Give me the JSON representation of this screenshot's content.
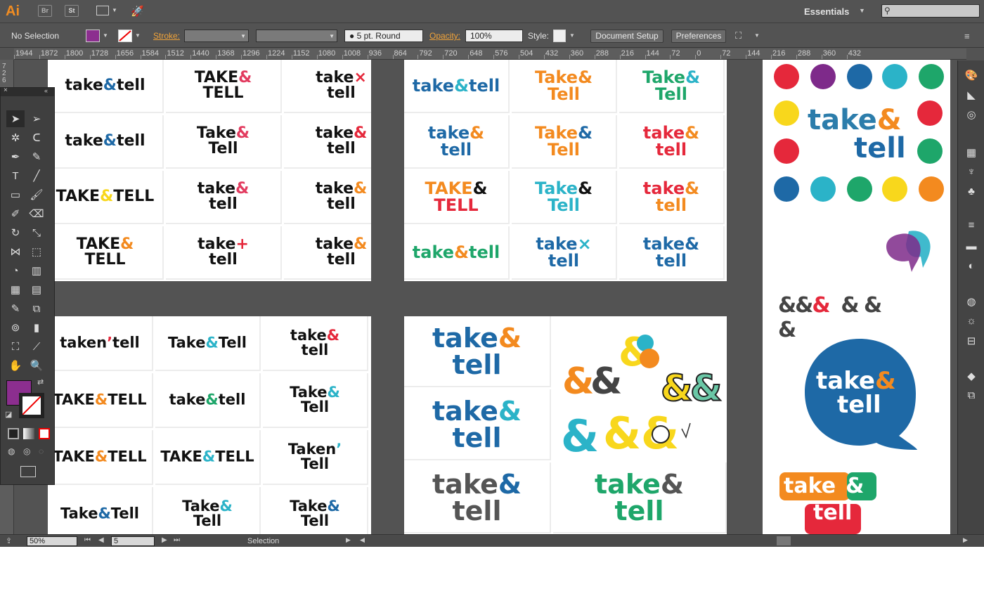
{
  "app": {
    "logo": "Ai",
    "bridge": "Br",
    "stock": "St",
    "workspace": "Essentials"
  },
  "control_bar": {
    "selection": "No Selection",
    "stroke_label": "Stroke:",
    "brush": "5 pt. Round",
    "opacity_label": "Opacity:",
    "opacity": "100%",
    "style_label": "Style:",
    "doc_setup": "Document Setup",
    "preferences": "Preferences"
  },
  "ruler_labels": [
    "1944",
    "1872",
    "1800",
    "1728",
    "1656",
    "1584",
    "1512",
    "1440",
    "1368",
    "1296",
    "1224",
    "1152",
    "1080",
    "1008",
    "936",
    "864",
    "792",
    "720",
    "648",
    "576",
    "504",
    "432",
    "360",
    "288",
    "216",
    "144",
    "72",
    "0",
    "72",
    "144",
    "216",
    "288",
    "360",
    "432"
  ],
  "vruler_labels": [
    "7",
    "2",
    "6"
  ],
  "status": {
    "zoom": "50%",
    "artboard": "5",
    "tool": "Selection"
  },
  "colors": {
    "blue": "#1e69a6",
    "orange": "#f38a1f",
    "red": "#e5283b",
    "green": "#1ea66a",
    "teal": "#2bb3c8",
    "purple": "#7e2a8a",
    "yellow": "#f8d71c",
    "pink": "#e23b5f",
    "black": "#111111",
    "gray": "#555555",
    "fill_swatch": "#8c2e8f"
  },
  "dots": [
    "red",
    "purple",
    "blue",
    "teal",
    "green",
    "yellow",
    "red",
    "red",
    "green",
    "blue",
    "teal",
    "green",
    "yellow",
    "orange"
  ],
  "logos": {
    "tl": [
      [
        "take",
        "&",
        "tell",
        "",
        "black",
        "blue",
        "black"
      ],
      [
        "TAKE",
        "&",
        "TELL",
        "",
        "black",
        "pink",
        "black"
      ],
      [
        "take",
        "×",
        "tell",
        "",
        "black",
        "red",
        "black"
      ],
      [
        "take",
        "&",
        "tell",
        "",
        "black",
        "blue",
        "black"
      ],
      [
        "Take",
        "&",
        "Tell",
        "",
        "black",
        "pink",
        "black"
      ],
      [
        "take",
        "&",
        "tell",
        "",
        "black",
        "red",
        "black"
      ],
      [
        "TAKE",
        "&",
        "TELL",
        "",
        "black",
        "yellow",
        "black"
      ],
      [
        "take",
        "&",
        "tell",
        "",
        "black",
        "pink",
        "black"
      ],
      [
        "take",
        "&",
        "tell",
        "",
        "black",
        "orange",
        "black"
      ],
      [
        "TAKE",
        "&",
        "TELL",
        "",
        "black",
        "orange",
        "black"
      ],
      [
        "take",
        "+",
        "tell",
        "",
        "black",
        "red",
        "black"
      ],
      [
        "take",
        "&",
        "tell",
        "",
        "black",
        "orange",
        "black"
      ]
    ],
    "tm": [
      [
        "take",
        "&",
        "tell",
        "",
        "blue",
        "teal",
        "blue"
      ],
      [
        "Take",
        "&",
        "Tell",
        "",
        "orange",
        "orange",
        "orange"
      ],
      [
        "Take",
        "&",
        "Tell",
        "",
        "green",
        "teal",
        "green"
      ],
      [
        "take",
        "&",
        "tell",
        "",
        "blue",
        "orange",
        "blue"
      ],
      [
        "Take",
        "&",
        "Tell",
        "",
        "orange",
        "blue",
        "orange"
      ],
      [
        "take",
        "&",
        "tell",
        "",
        "red",
        "orange",
        "red"
      ],
      [
        "TAKE",
        "&",
        "TELL",
        "",
        "orange",
        "black",
        "red"
      ],
      [
        "Take",
        "&",
        "Tell",
        "",
        "teal",
        "black",
        "teal"
      ],
      [
        "take",
        "&",
        "tell",
        "",
        "red",
        "orange",
        "orange"
      ],
      [
        "take",
        "&",
        "tell",
        "",
        "green",
        "orange",
        "green"
      ],
      [
        "take",
        "×",
        "tell",
        "",
        "blue",
        "teal",
        "blue"
      ],
      [
        "take",
        "&",
        "tell",
        "",
        "blue",
        "blue",
        "blue"
      ]
    ],
    "bl": [
      [
        "taken",
        "’",
        "tell",
        "",
        "black",
        "red",
        "black"
      ],
      [
        "Take",
        "&",
        "Tell",
        "",
        "black",
        "teal",
        "black"
      ],
      [
        "take",
        "&",
        "tell",
        "",
        "black",
        "red",
        "black"
      ],
      [
        "TAKE",
        "&",
        "TELL",
        "",
        "black",
        "orange",
        "black"
      ],
      [
        "take",
        "&",
        "tell",
        "",
        "black",
        "green",
        "black"
      ],
      [
        "Take",
        "&",
        "Tell",
        "",
        "black",
        "teal",
        "black"
      ],
      [
        "TAKE",
        "&",
        "TELL",
        "",
        "black",
        "orange",
        "black"
      ],
      [
        "TAKE",
        "&",
        "TELL",
        "",
        "black",
        "teal",
        "black"
      ],
      [
        "Taken",
        "’",
        "Tell",
        "",
        "black",
        "teal",
        "black"
      ],
      [
        "Take",
        "&",
        "Tell",
        "",
        "black",
        "blue",
        "black"
      ],
      [
        "Take",
        "&",
        "Tell",
        "",
        "black",
        "teal",
        "black"
      ],
      [
        "Take",
        "&",
        "Tell",
        "",
        "black",
        "blue",
        "black"
      ]
    ],
    "bm": [
      [
        "take",
        "&",
        "tell",
        "",
        "blue",
        "orange",
        "blue"
      ],
      [
        "take",
        "&",
        "tell",
        "",
        "blue",
        "teal",
        "blue"
      ],
      [
        "take",
        "&",
        "tell",
        "",
        "gray",
        "blue",
        "gray"
      ],
      [
        "take",
        "&",
        "tell",
        "",
        "green",
        "gray",
        "green"
      ]
    ],
    "r_big": [
      "take",
      "&",
      "tell"
    ],
    "r_bubble": [
      "take",
      "&",
      "tell"
    ],
    "r_bottom": [
      "take",
      "&",
      "tell"
    ]
  }
}
